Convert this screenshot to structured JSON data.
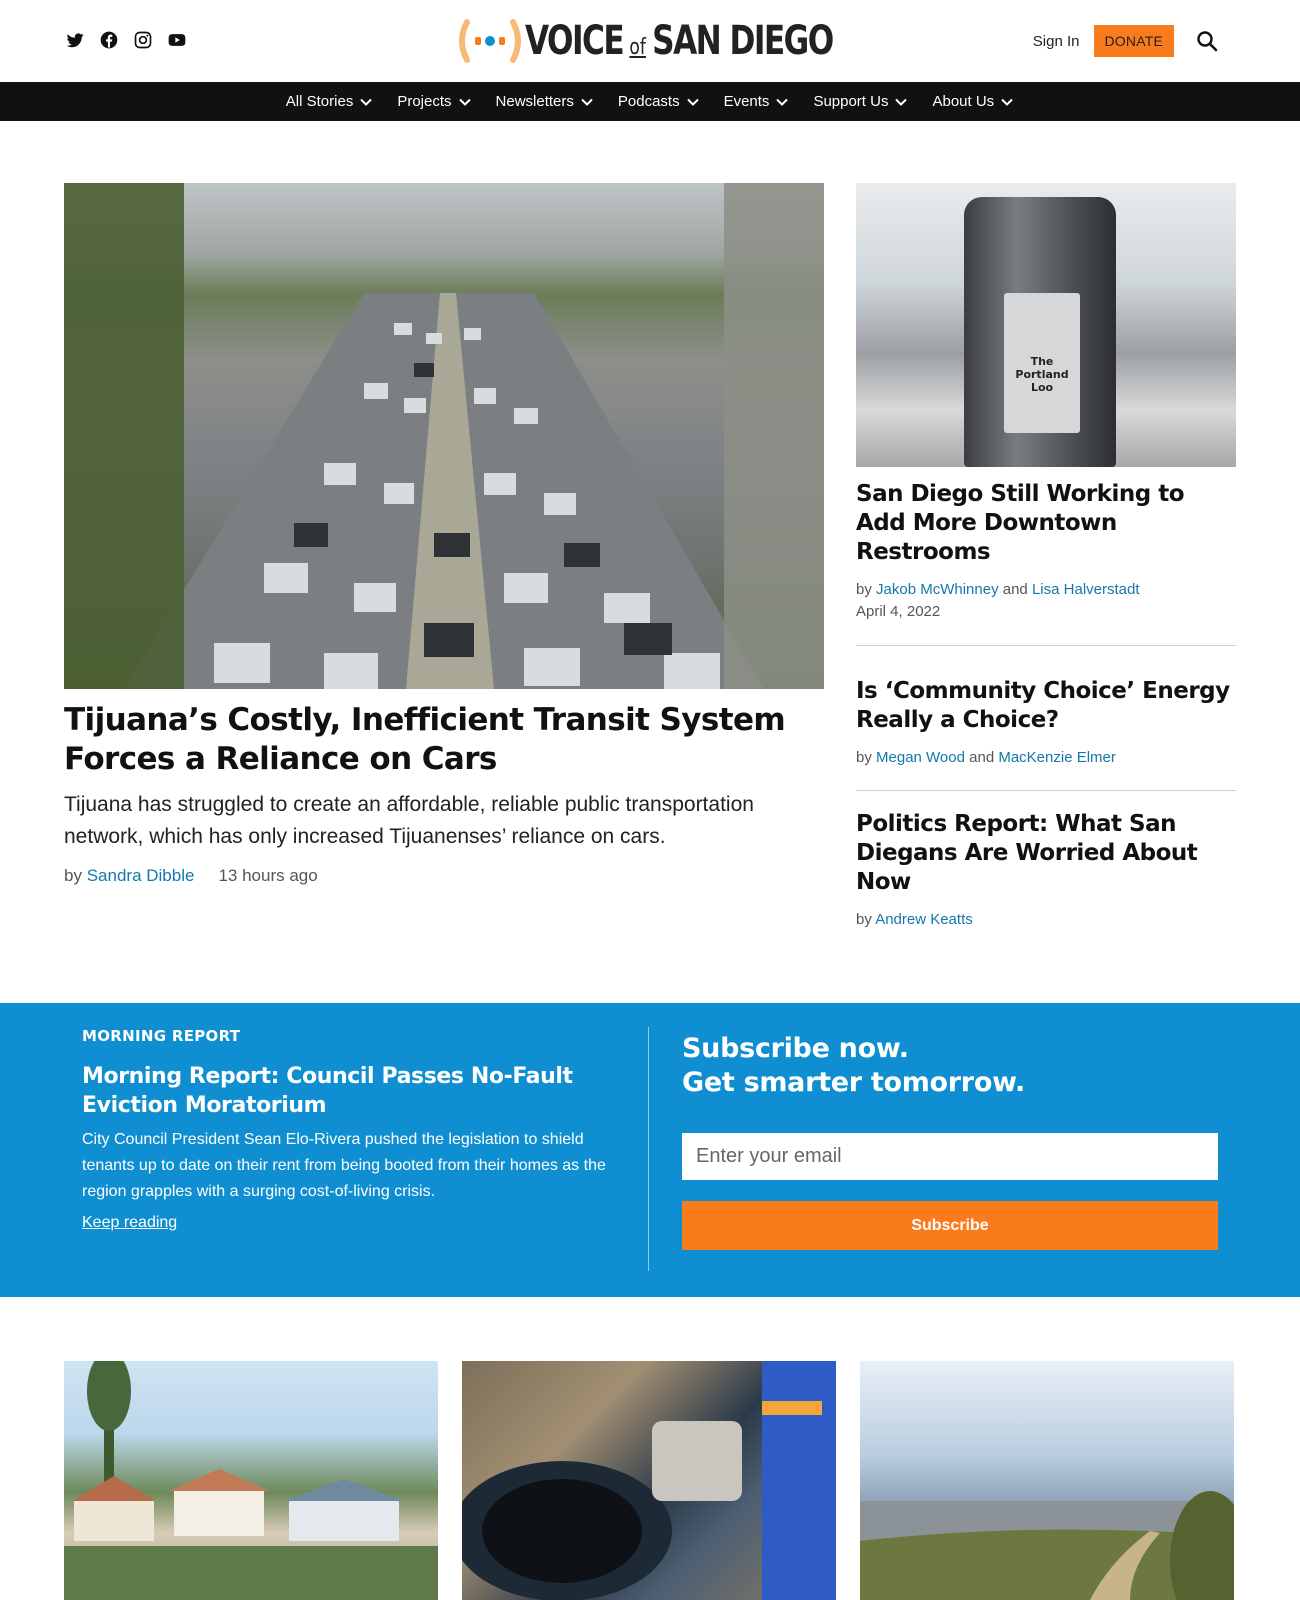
{
  "header": {
    "social": [
      "twitter-icon",
      "facebook-icon",
      "instagram-icon",
      "youtube-icon"
    ],
    "logo": {
      "voice": "VOICE",
      "of": "of",
      "rest": "SAN DIEGO"
    },
    "sign_in": "Sign In",
    "donate": "DONATE",
    "accent": "#fa7b1c"
  },
  "nav": [
    "All Stories",
    "Projects",
    "Newsletters",
    "Podcasts",
    "Events",
    "Support Us",
    "About Us"
  ],
  "hero": {
    "title": "Tijuana’s Costly, Inefficient Transit System Forces a Reliance on Cars",
    "dek": "Tijuana has struggled to create an affordable, reliable public transportation network, which has only increased Tijuanenses’ reliance on cars.",
    "by": "by",
    "author": "Sandra Dibble",
    "time": "13 hours ago"
  },
  "side": [
    {
      "title": "San Diego Still Working to Add More Downtown Restrooms",
      "by": "by",
      "author1": "Jakob McWhinney",
      "and": "and",
      "author2": "Lisa Halverstadt",
      "date": "April 4, 2022",
      "sign_text": "The Portland Loo"
    },
    {
      "title": "Is ‘Community Choice’ Energy Really a Choice?",
      "by": "by",
      "author1": "Megan Wood",
      "and": "and",
      "author2": "MacKenzie Elmer"
    },
    {
      "title": "Politics Report: What San Diegans Are Worried About Now",
      "by": "by",
      "author1": "Andrew Keatts"
    }
  ],
  "morning": {
    "kicker": "MORNING REPORT",
    "title": "Morning Report: Council Passes No-Fault Eviction Moratorium",
    "dek": "City Council President Sean Elo-Rivera pushed the legislation to shield tenants up to date on their rent from being booted from their homes as the region grapples with a surging cost-of-living crisis.",
    "link": "Keep reading",
    "band_color": "#0f8fd1"
  },
  "subscribe": {
    "line1": "Subscribe now.",
    "line2": "Get smarter tomorrow.",
    "placeholder": "Enter your email",
    "button": "Subscribe"
  }
}
